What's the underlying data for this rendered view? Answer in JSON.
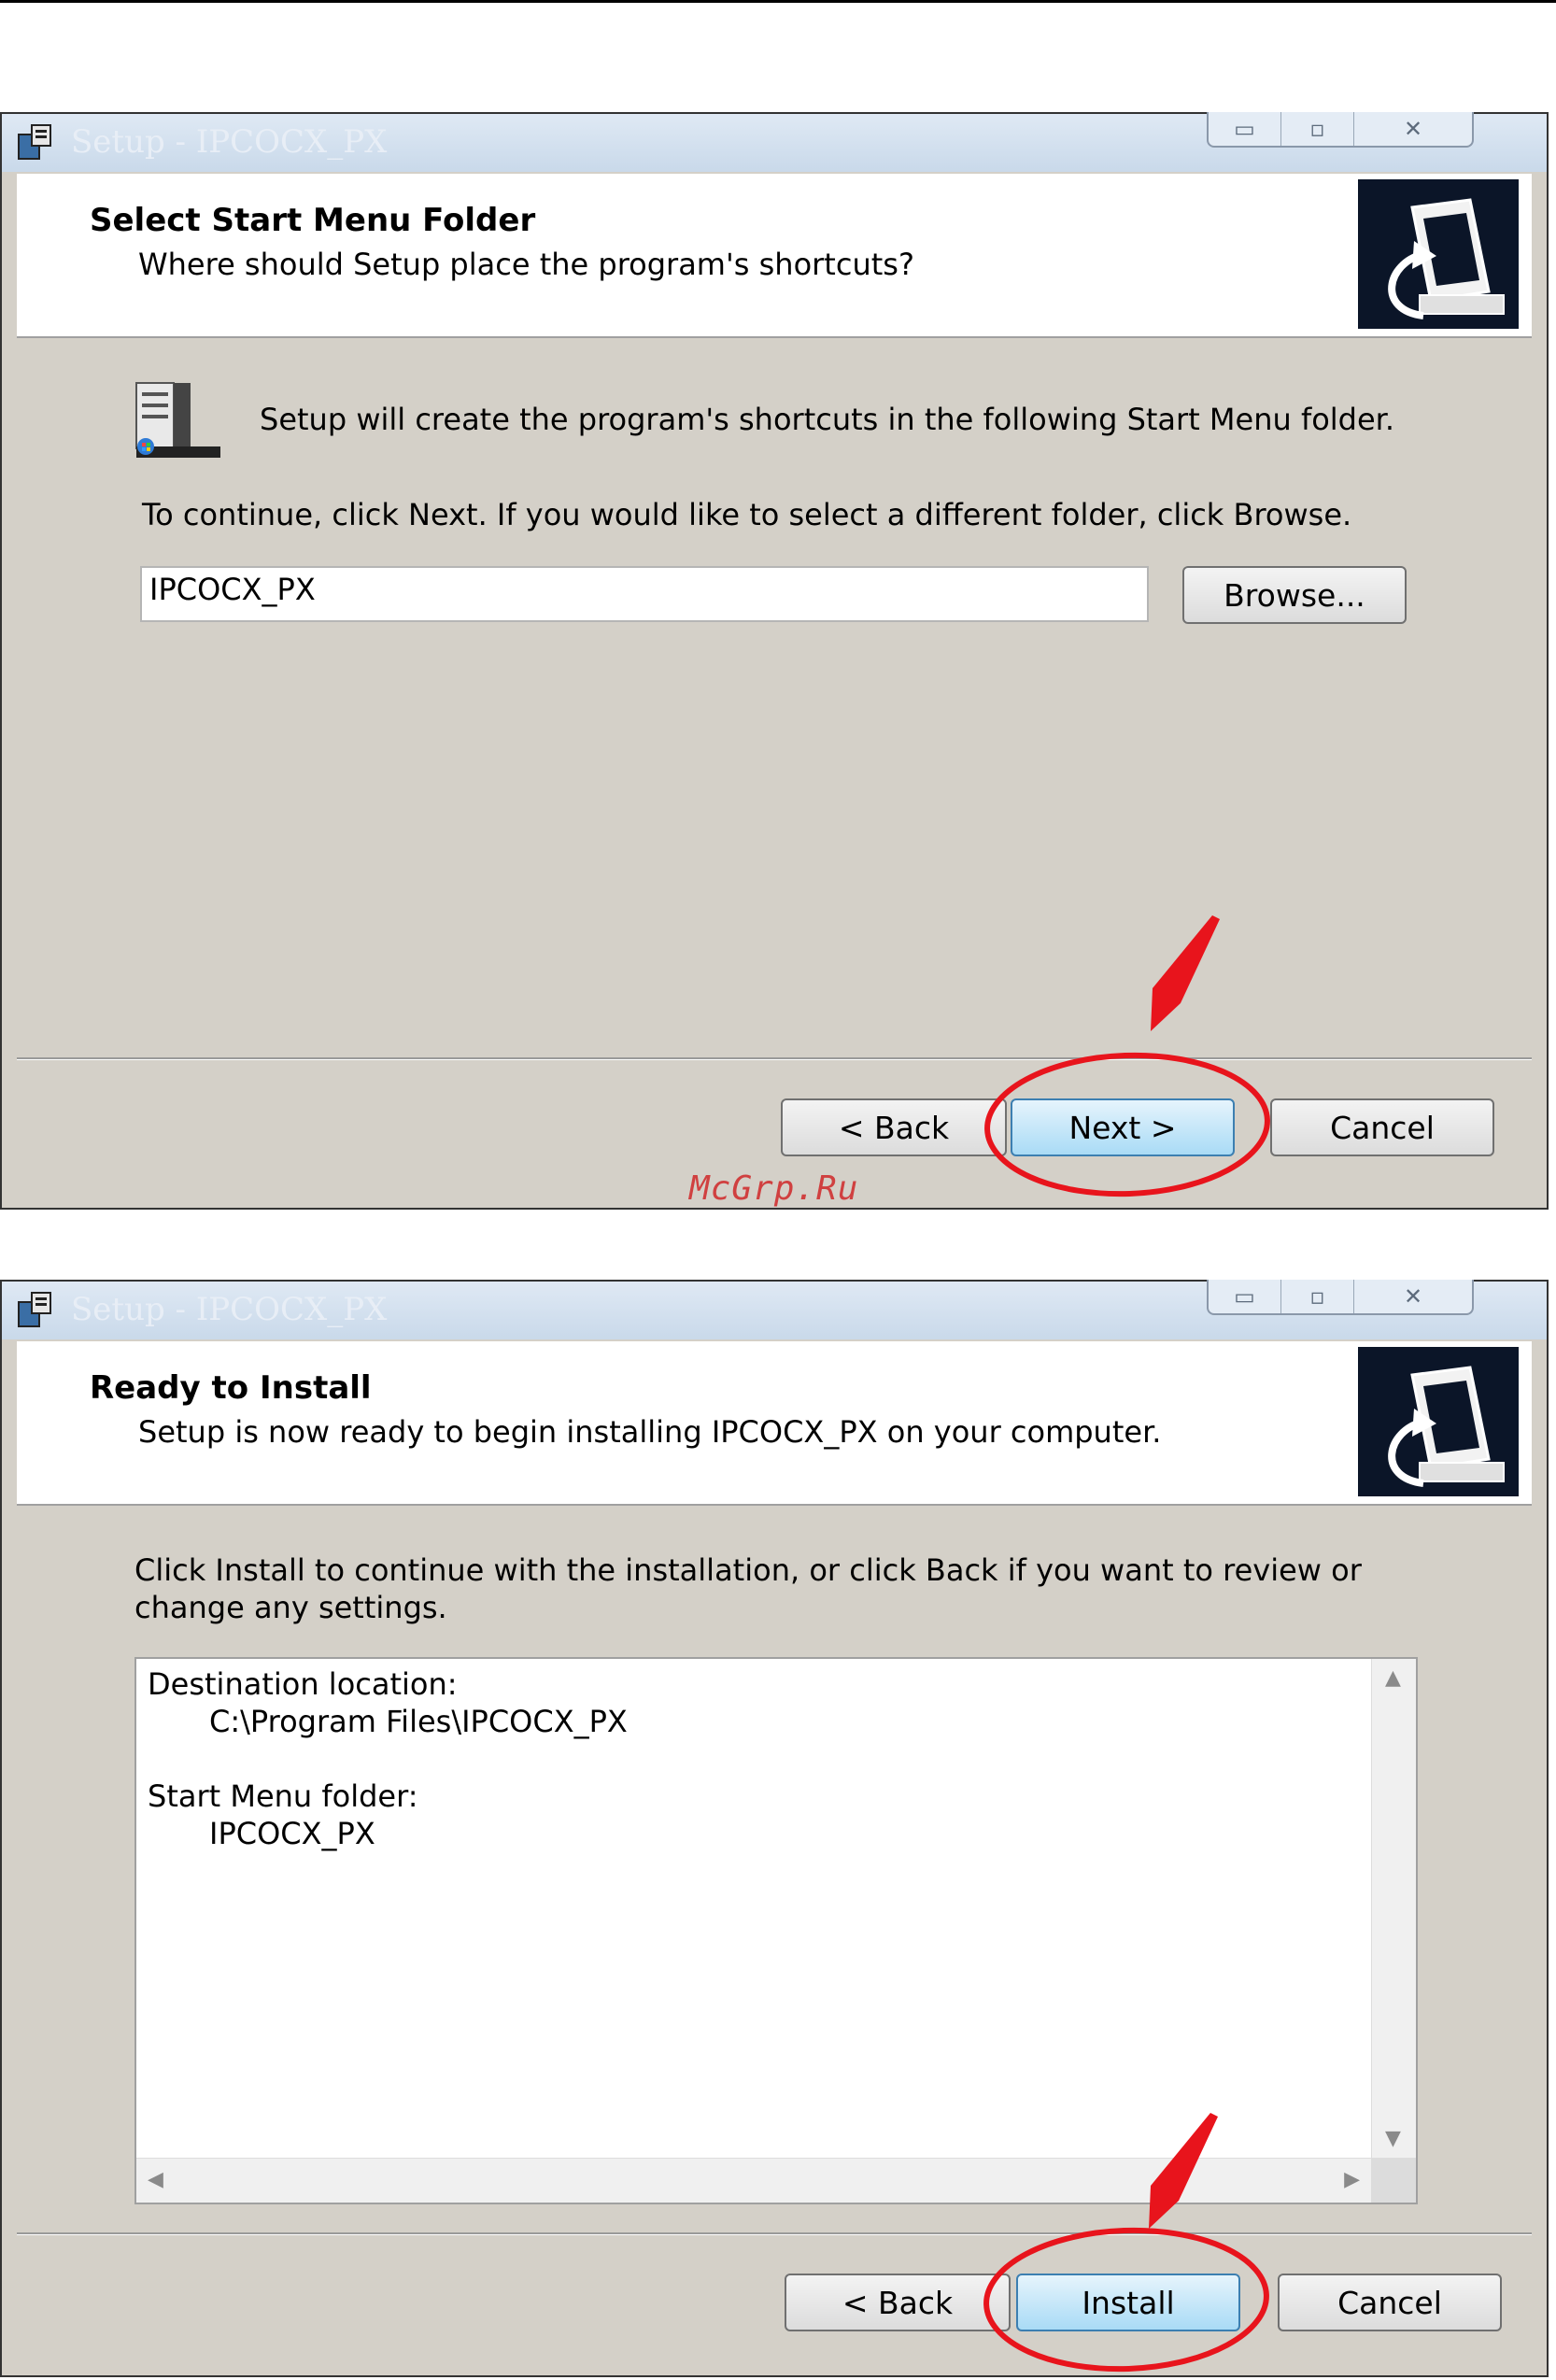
{
  "win1": {
    "title": "Setup - IPCOCX_PX",
    "header_title": "Select Start Menu Folder",
    "header_subtitle": "Where should Setup place the program's shortcuts?",
    "info_text": "Setup will create the program's shortcuts in the following Start Menu folder.",
    "continue_text": "To continue, click Next. If you would like to select a different folder, click Browse.",
    "folder_value": "IPCOCX_PX",
    "browse_label": "Browse...",
    "back_label": "< Back",
    "next_label": "Next >",
    "cancel_label": "Cancel"
  },
  "watermark": "McGrp.Ru",
  "win2": {
    "title": "Setup - IPCOCX_PX",
    "header_title": "Ready to Install",
    "header_subtitle": "Setup is now ready to begin installing IPCOCX_PX on your computer.",
    "info_line1": "Click Install to continue with the installation, or click Back if you want to review or",
    "info_line2": "change any settings.",
    "memo": {
      "dest_label": "Destination location:",
      "dest_value": "C:\\Program Files\\IPCOCX_PX",
      "start_label": "Start Menu folder:",
      "start_value": "IPCOCX_PX"
    },
    "back_label": "< Back",
    "install_label": "Install",
    "cancel_label": "Cancel"
  },
  "colors": {
    "annotation": "#e8141c",
    "primary_button": "#a9dbf6"
  },
  "icons": [
    "setup-app-icon",
    "minimize-icon",
    "maximize-icon",
    "close-icon",
    "wizard-computer-icon",
    "start-menu-folder-icon",
    "scroll-up-icon",
    "scroll-down-icon",
    "scroll-left-icon",
    "scroll-right-icon"
  ]
}
